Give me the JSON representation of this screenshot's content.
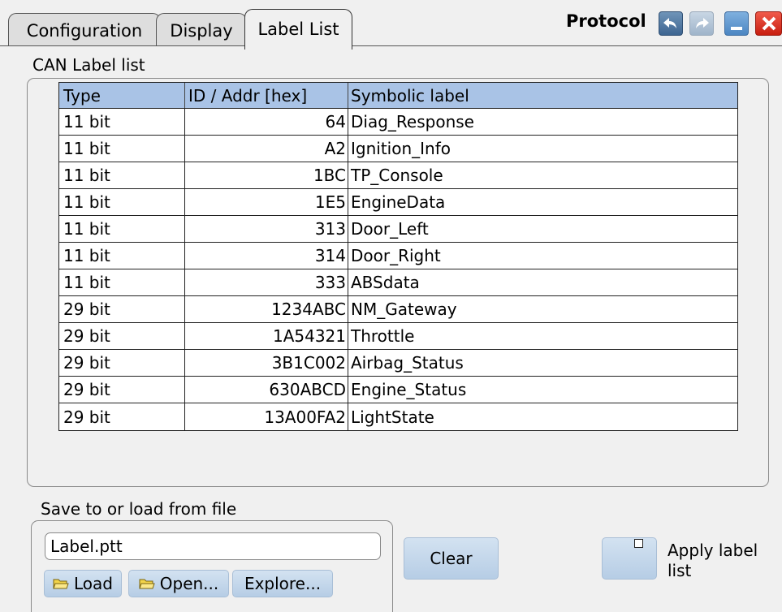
{
  "tabs": {
    "configuration": "Configuration",
    "display": "Display",
    "label_list": "Label List"
  },
  "title": "Protocol",
  "toolbar_icons": [
    "undo-icon",
    "redo-icon",
    "minimize-icon",
    "close-icon"
  ],
  "label_list": {
    "group_label": "CAN Label list",
    "columns": [
      "Type",
      "ID / Addr [hex]",
      "Symbolic label"
    ],
    "rows": [
      [
        "11 bit",
        "64",
        "Diag_Response"
      ],
      [
        "11 bit",
        "A2",
        "Ignition_Info"
      ],
      [
        "11 bit",
        "1BC",
        "TP_Console"
      ],
      [
        "11 bit",
        "1E5",
        "EngineData"
      ],
      [
        "11 bit",
        "313",
        "Door_Left"
      ],
      [
        "11 bit",
        "314",
        "Door_Right"
      ],
      [
        "11 bit",
        "333",
        "ABSdata"
      ],
      [
        "29 bit",
        "1234ABC",
        "NM_Gateway"
      ],
      [
        "29 bit",
        "1A54321",
        "Throttle"
      ],
      [
        "29 bit",
        "3B1C002",
        "Airbag_Status"
      ],
      [
        "29 bit",
        "630ABCD",
        "Engine_Status"
      ],
      [
        "29 bit",
        "13A00FA2",
        "LightState"
      ]
    ]
  },
  "file": {
    "group_label": "Save to or load from file",
    "filename": "Label.ptt",
    "load_label": "Load",
    "open_label": "Open...",
    "explore_label": "Explore..."
  },
  "clear_label": "Clear",
  "apply": {
    "label": "Apply label list",
    "checked": false
  },
  "colors": {
    "header_bg": "#a9c3e6",
    "button_bg": "#c5d8ec",
    "close_red": "#d9261a"
  }
}
